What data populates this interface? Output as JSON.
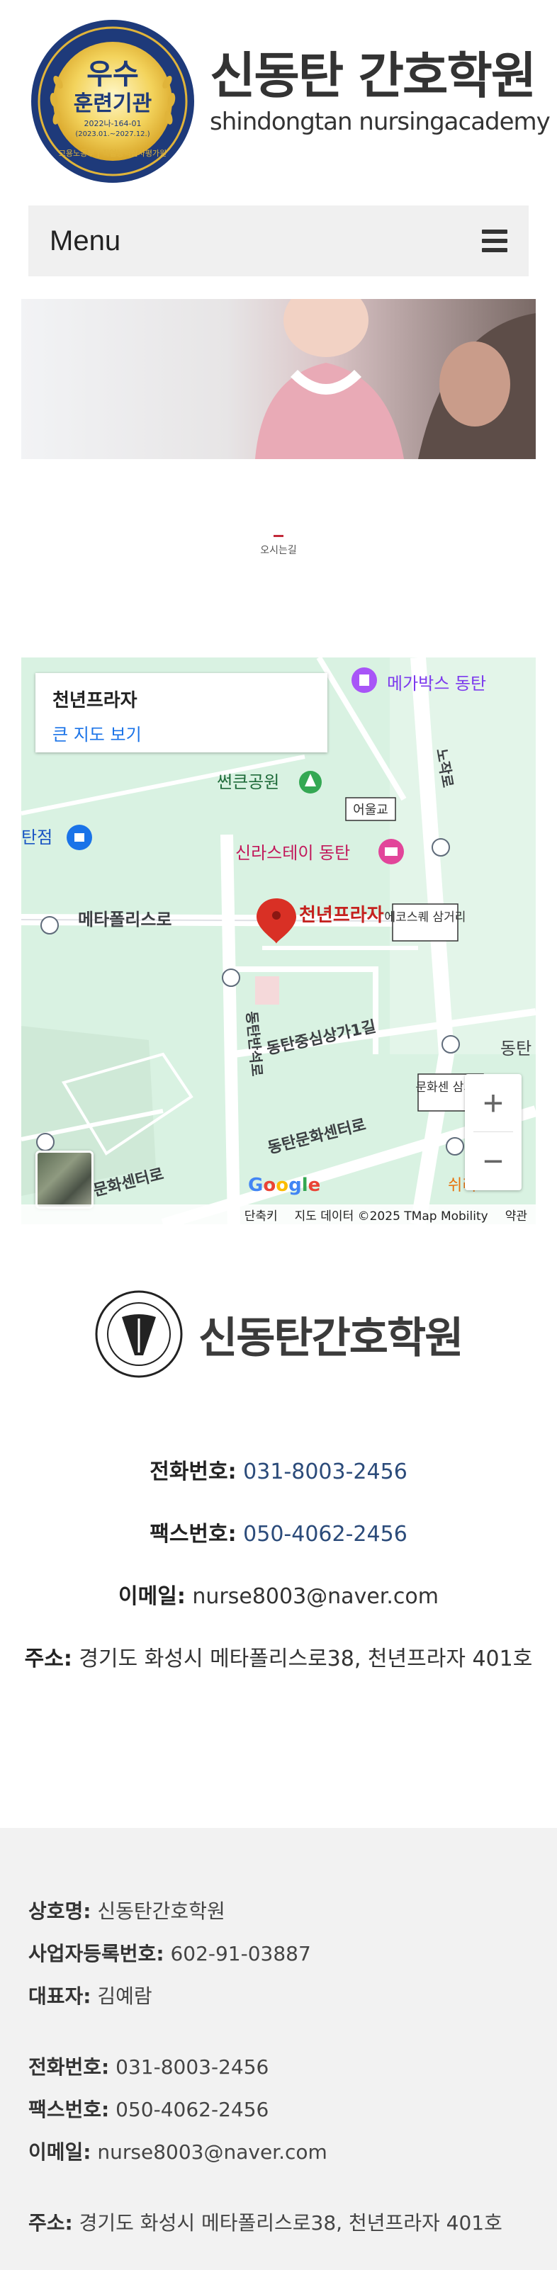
{
  "header": {
    "badge": {
      "title_line1": "우수",
      "title_line2": "훈련기관",
      "code": "2022나-164-01",
      "period": "(2023.01.~2027.12.)",
      "ring_text": "고용노동부 | 직업능력심사평가원"
    },
    "brand_ko": "신동탄 간호학원",
    "brand_en": "shindongtan nursingacademy"
  },
  "menu": {
    "label": "Menu",
    "icon": "hamburger-icon"
  },
  "hero": {
    "description_visible": false
  },
  "caption": {
    "text": "오시는길",
    "accent_color": "#c22a3a"
  },
  "map": {
    "place_title": "천년프라자",
    "view_larger": "큰 지도 보기",
    "marker_label": "천년프라자",
    "labels": {
      "megabox": "메가박스 동탄",
      "park": "썬큰공원",
      "hotel": "신라스테이 동탄",
      "metapolis_ro": "메타폴리스로",
      "eoulgyo": "어울교",
      "ecosquare": "에코스퀘 삼거리",
      "dongtan_center": "동탄중심상가1길",
      "banseok": "동탄반석로",
      "munhwa_center": "동탄문화센터로",
      "munhwa_junction": "문화센 삼거리",
      "station": "탄점",
      "munhwa_left": "문화센터로",
      "dongtan_right": "동탄",
      "nojak": "노작로",
      "sheel": "쉬리"
    },
    "footer": {
      "shortcuts": "단축키",
      "map_data": "지도 데이터 ©2025 TMap Mobility",
      "terms": "약관"
    },
    "google": "Google",
    "zoom_in": "+",
    "zoom_out": "−"
  },
  "contact": {
    "logo_text": "신동탄간호학원",
    "phone_label": "전화번호:",
    "phone": "031-8003-2456",
    "fax_label": "팩스번호:",
    "fax": "050-4062-2456",
    "email_label": "이메일:",
    "email": "nurse8003@naver.com",
    "address_label": "주소:",
    "address": "경기도 화성시 메타폴리스로38, 천년프라자 401호"
  },
  "footer": {
    "company_label": "상호명:",
    "company": "신동탄간호학원",
    "biz_no_label": "사업자등록번호:",
    "biz_no": "602-91-03887",
    "ceo_label": "대표자:",
    "ceo": "김예람",
    "phone_label": "전화번호:",
    "phone": "031-8003-2456",
    "fax_label": "팩스번호:",
    "fax": "050-4062-2456",
    "email_label": "이메일:",
    "email": "nurse8003@naver.com",
    "address_label": "주소:",
    "address": "경기도 화성시 메타폴리스로38, 천년프라자 401호"
  },
  "colors": {
    "accent": "#c22a3a",
    "link_blue": "#1a73e8",
    "contact_blue": "#2b4b7a",
    "badge_navy": "#1e3a7a",
    "badge_gold": "#e0b43a"
  }
}
